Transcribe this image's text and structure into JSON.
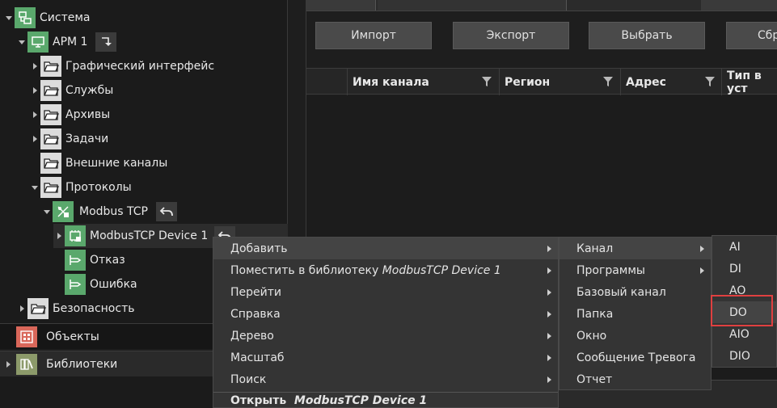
{
  "tree": {
    "items": [
      {
        "label": "Система"
      },
      {
        "label": "АРМ 1"
      },
      {
        "label": "Графический интерфейс"
      },
      {
        "label": "Службы"
      },
      {
        "label": "Архивы"
      },
      {
        "label": "Задачи"
      },
      {
        "label": "Внешние каналы"
      },
      {
        "label": "Протоколы"
      },
      {
        "label": "Modbus TCP"
      },
      {
        "label": "ModbusTCP Device 1"
      },
      {
        "label": "Отказ"
      },
      {
        "label": "Ошибка"
      },
      {
        "label": "Безопасность"
      }
    ],
    "sections": [
      {
        "label": "Объекты",
        "color": "#d9675a"
      },
      {
        "label": "Библиотеки",
        "color": "#8c9a6a"
      }
    ]
  },
  "toolbar": {
    "import_label": "Импорт",
    "export_label": "Экспорт",
    "select_label": "Выбрать",
    "reset_label": "Сбр"
  },
  "grid": {
    "columns": [
      "Имя канала",
      "Регион",
      "Адрес",
      "Тип в уст"
    ]
  },
  "context_menu": {
    "items": [
      {
        "label": "Добавить"
      },
      {
        "label": "Поместить в библиотеку ",
        "emph": "ModbusTCP Device 1"
      },
      {
        "label": "Перейти"
      },
      {
        "label": "Справка"
      },
      {
        "label": "Дерево"
      },
      {
        "label": "Масштаб"
      },
      {
        "label": "Поиск"
      },
      {
        "label": "Открыть  ",
        "emph": "ModbusTCP Device 1"
      }
    ]
  },
  "add_submenu": {
    "items": [
      {
        "label": "Канал"
      },
      {
        "label": "Программы"
      },
      {
        "label": "Базовый канал"
      },
      {
        "label": "Папка"
      },
      {
        "label": "Окно"
      },
      {
        "label": "Сообщение Тревога"
      },
      {
        "label": "Отчет"
      }
    ]
  },
  "channel_submenu": {
    "items": [
      {
        "label": "AI"
      },
      {
        "label": "DI"
      },
      {
        "label": "AO"
      },
      {
        "label": "DO"
      },
      {
        "label": "AIO"
      },
      {
        "label": "DIO"
      }
    ]
  },
  "colors": {
    "green_icon": "#5aa86c",
    "highlight": "#e04040"
  }
}
